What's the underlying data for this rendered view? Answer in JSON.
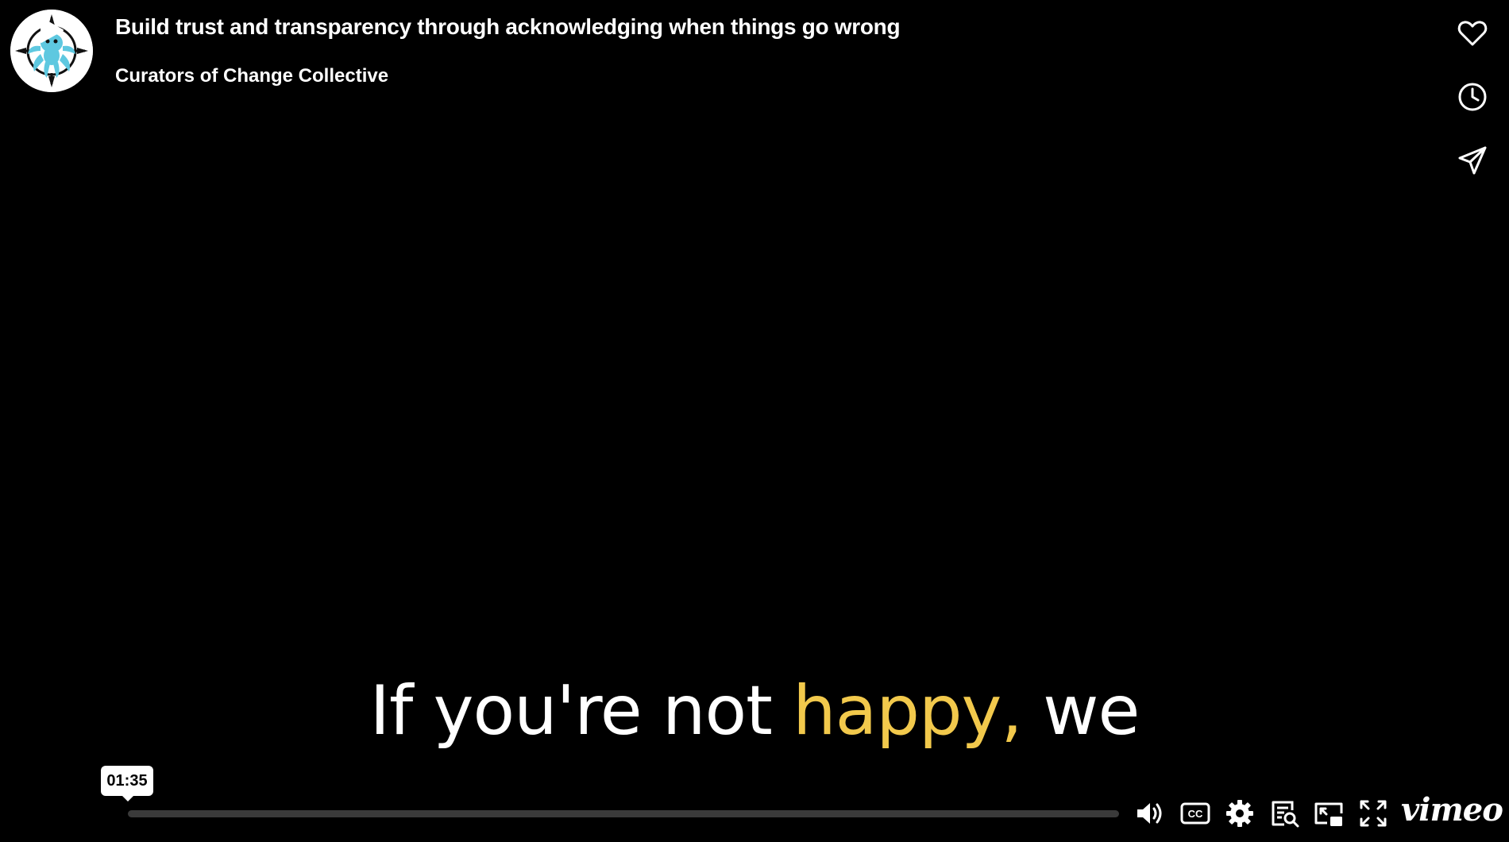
{
  "video": {
    "title": "Build trust and transparency through acknowledging when things go wrong",
    "channel": "Curators of Change Collective",
    "progress_percent": 0,
    "hover_time": "01:35"
  },
  "caption": {
    "before": "If you're not ",
    "highlight": "happy,",
    "after": " we",
    "highlight_color": "#f2c94c"
  },
  "side_actions": [
    {
      "icon": "heart-icon"
    },
    {
      "icon": "clock-icon"
    },
    {
      "icon": "send-icon"
    }
  ],
  "control_icons": [
    "play-icon",
    "volume-icon",
    "cc-icon",
    "gear-icon",
    "transcript-icon",
    "pip-icon",
    "fullscreen-icon"
  ],
  "brand": {
    "logo_text": "vimeo"
  }
}
